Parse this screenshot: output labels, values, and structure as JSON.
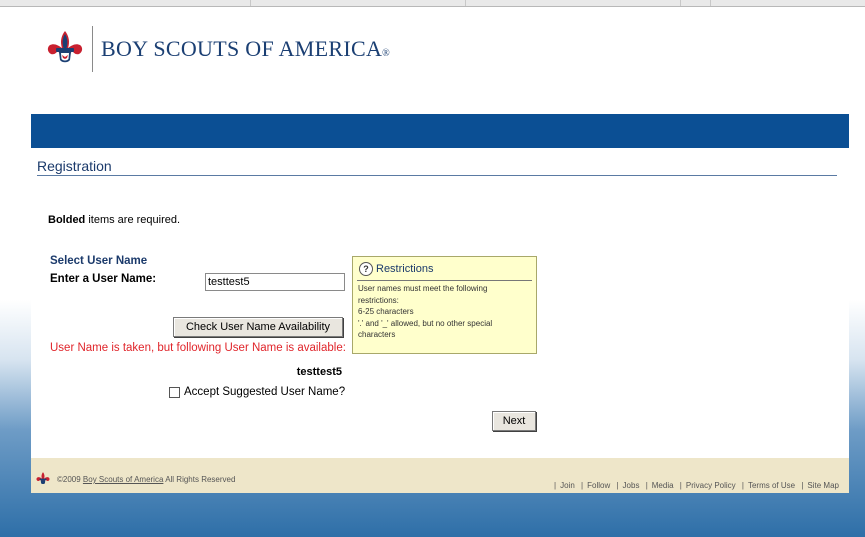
{
  "header": {
    "org_name": "BOY SCOUTS OF AMERICA",
    "registered_mark": "®"
  },
  "page": {
    "title": "Registration"
  },
  "form": {
    "required_note_bold": "Bolded",
    "required_note_rest": " items are required.",
    "select_heading": "Select User Name",
    "enter_label": "Enter a User Name:",
    "username_value": "testtest5",
    "check_button": "Check User Name Availability",
    "taken_message": "User Name is taken, but following User Name is available:",
    "suggested_username": "testtest5",
    "accept_label": "Accept Suggested User Name?",
    "accept_checked": false,
    "next_button": "Next"
  },
  "restrictions": {
    "title": "Restrictions",
    "icon": "question-icon",
    "lines": [
      "User names must meet the following",
      "restrictions:",
      "6-25 characters",
      "'.' and '_' allowed, but no other special",
      "characters"
    ]
  },
  "footer": {
    "copyright_prefix": "©2009 ",
    "copyright_link": "Boy Scouts of America",
    "copyright_suffix": "  All Rights Reserved",
    "links": [
      "Join",
      "Follow",
      "Jobs",
      "Media",
      "Privacy Policy",
      "Terms of Use",
      "Site Map"
    ]
  },
  "colors": {
    "brand_blue": "#0b4f94",
    "title_navy": "#1b3a6b",
    "error_red": "#e0252b",
    "tooltip_yellow": "#ffffcc",
    "footer_tan": "#eee6c9"
  }
}
